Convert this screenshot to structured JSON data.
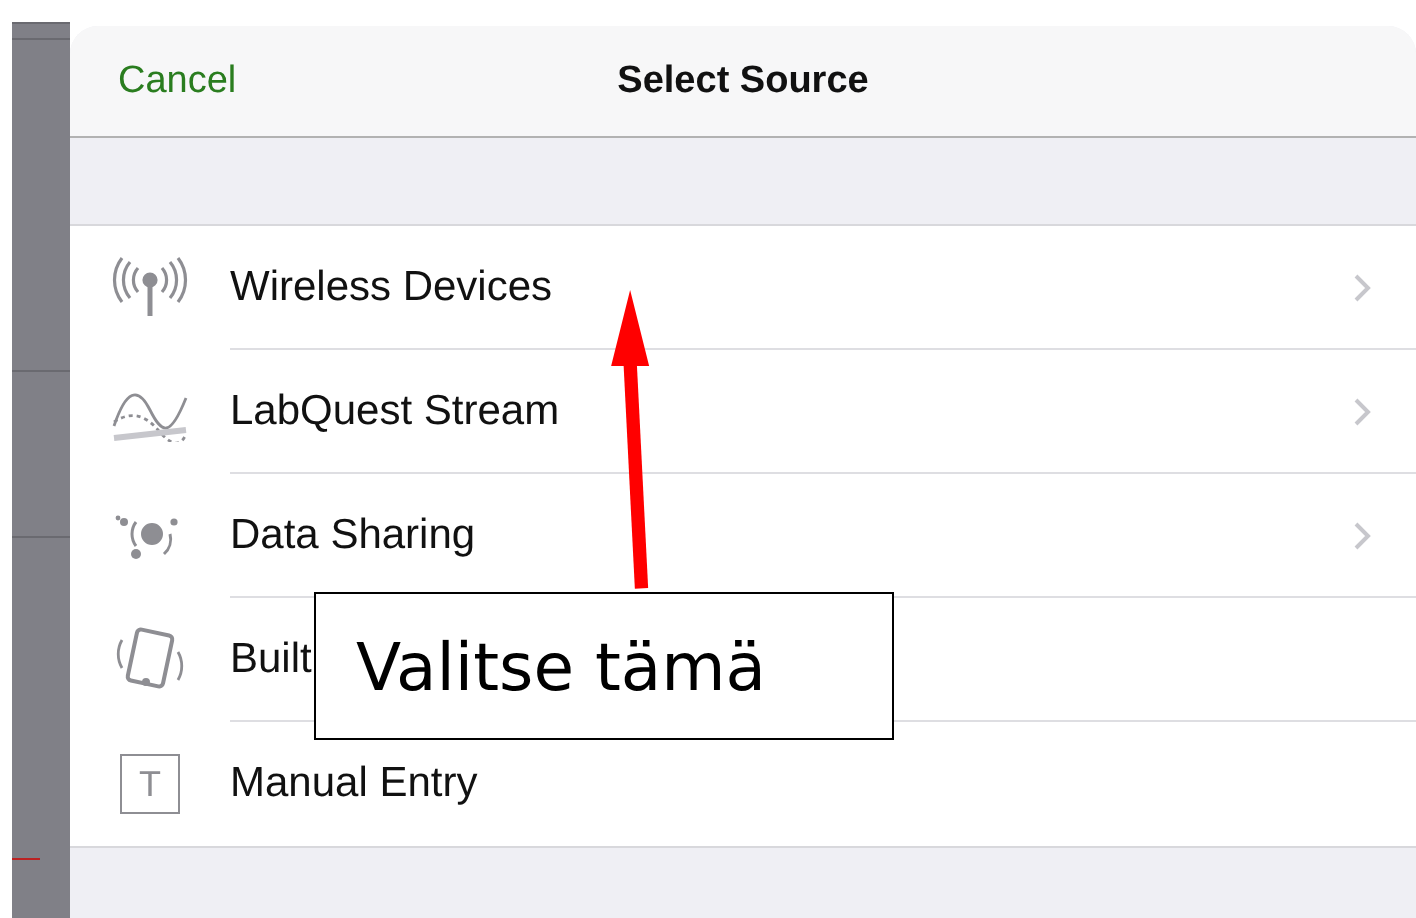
{
  "sheet": {
    "cancel": "Cancel",
    "title": "Select Source"
  },
  "sources": [
    {
      "kind": "wireless",
      "label": "Wireless Devices",
      "chevron": true
    },
    {
      "kind": "stream",
      "label": "LabQuest Stream",
      "chevron": true
    },
    {
      "kind": "sharing",
      "label": "Data Sharing",
      "chevron": true
    },
    {
      "kind": "device",
      "label": "Built",
      "chevron": false
    },
    {
      "kind": "text",
      "label": "Manual Entry",
      "chevron": false,
      "icon_letter": "T"
    }
  ],
  "callout": {
    "text": "Valitse tämä"
  }
}
